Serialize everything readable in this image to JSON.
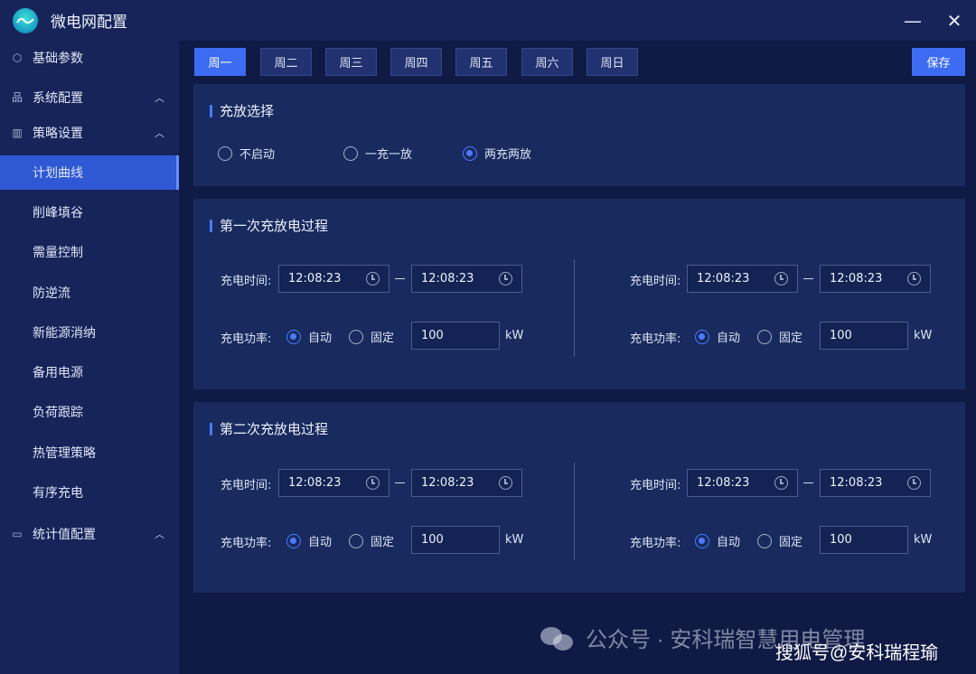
{
  "window": {
    "title": "微电网配置",
    "minimize": "—",
    "close": "✕"
  },
  "sidebar": {
    "groups": [
      {
        "label": "基础参数",
        "icon": "cube-icon"
      },
      {
        "label": "系统配置",
        "icon": "network-icon",
        "expanded": false
      },
      {
        "label": "策略设置",
        "icon": "chart-icon",
        "expanded": true
      },
      {
        "label": "统计值配置",
        "icon": "monitor-icon",
        "expanded": false
      }
    ],
    "items": [
      {
        "label": "计划曲线",
        "active": true
      },
      {
        "label": "削峰填谷"
      },
      {
        "label": "需量控制"
      },
      {
        "label": "防逆流"
      },
      {
        "label": "新能源消纳"
      },
      {
        "label": "备用电源"
      },
      {
        "label": "负荷跟踪"
      },
      {
        "label": "热管理策略"
      },
      {
        "label": "有序充电"
      }
    ]
  },
  "tabs": [
    "周一",
    "周二",
    "周三",
    "周四",
    "周五",
    "周六",
    "周日"
  ],
  "active_tab": "周一",
  "save_label": "保存",
  "charge_select": {
    "title": "充放选择",
    "options": [
      "不启动",
      "一充一放",
      "两充两放"
    ],
    "selected": "两充两放"
  },
  "labels": {
    "charge_time": "充电时间:",
    "charge_power": "充电功率:",
    "auto": "自动",
    "fixed": "固定",
    "unit": "kW"
  },
  "processes": [
    {
      "title": "第一次充放电过程",
      "left": {
        "start": "12:08:23",
        "end": "12:08:23",
        "power": "100",
        "mode": "自动"
      },
      "right": {
        "start": "12:08:23",
        "end": "12:08:23",
        "power": "100",
        "mode": "自动"
      }
    },
    {
      "title": "第二次充放电过程",
      "left": {
        "start": "12:08:23",
        "end": "12:08:23",
        "power": "100",
        "mode": "自动"
      },
      "right": {
        "start": "12:08:23",
        "end": "12:08:23",
        "power": "100",
        "mode": "自动"
      }
    }
  ],
  "watermarks": {
    "wechat": "公众号 · 安科瑞智慧用电管理",
    "sohu": "搜狐号@安科瑞程瑜"
  }
}
